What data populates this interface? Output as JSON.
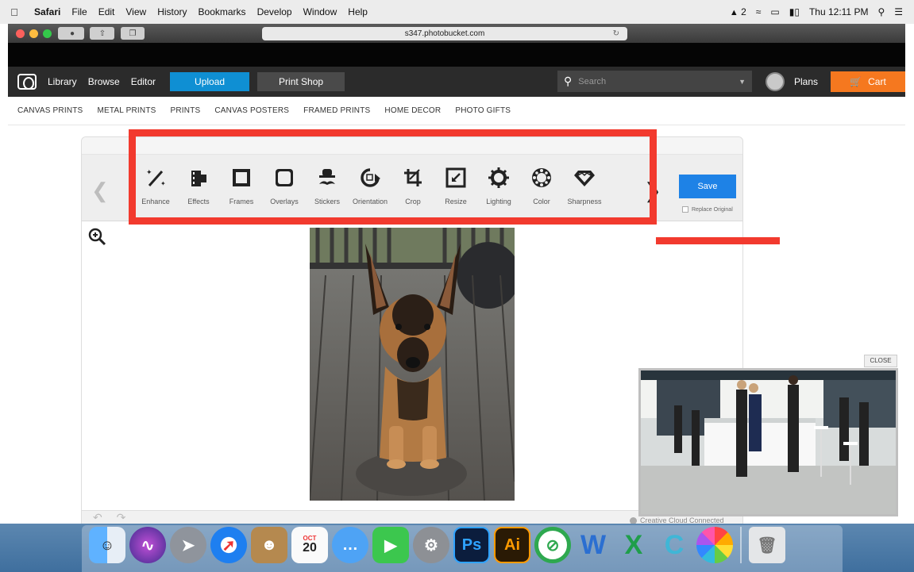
{
  "menubar": {
    "app": "Safari",
    "items": [
      "File",
      "Edit",
      "View",
      "History",
      "Bookmarks",
      "Develop",
      "Window",
      "Help"
    ],
    "status_badge": "2",
    "clock": "Thu 12:11 PM"
  },
  "safari": {
    "url": "s347.photobucket.com"
  },
  "nav": {
    "links": [
      "Library",
      "Browse",
      "Editor"
    ],
    "upload": "Upload",
    "print_shop": "Print Shop",
    "search_placeholder": "Search",
    "plans": "Plans",
    "cart": "Cart"
  },
  "categories": [
    "CANVAS PRINTS",
    "METAL PRINTS",
    "PRINTS",
    "CANVAS POSTERS",
    "FRAMED PRINTS",
    "HOME DECOR",
    "PHOTO GIFTS"
  ],
  "editor": {
    "tools": [
      {
        "label": "Enhance",
        "icon": "magic-wand-icon"
      },
      {
        "label": "Effects",
        "icon": "film-icon"
      },
      {
        "label": "Frames",
        "icon": "frame-icon"
      },
      {
        "label": "Overlays",
        "icon": "overlay-icon"
      },
      {
        "label": "Stickers",
        "icon": "hat-mustache-icon"
      },
      {
        "label": "Orientation",
        "icon": "rotate-icon"
      },
      {
        "label": "Crop",
        "icon": "crop-icon"
      },
      {
        "label": "Resize",
        "icon": "resize-icon"
      },
      {
        "label": "Lighting",
        "icon": "sun-icon"
      },
      {
        "label": "Color",
        "icon": "color-wheel-icon"
      },
      {
        "label": "Sharpness",
        "icon": "diamond-icon"
      }
    ],
    "save": "Save",
    "replace_original": "Replace Original"
  },
  "video": {
    "close": "CLOSE",
    "status": "Creative Cloud Connected"
  },
  "dock": {
    "calendar_month": "OCT",
    "calendar_day": "20",
    "apps": [
      "finder-icon",
      "siri-icon",
      "launchpad-icon",
      "safari-icon",
      "contacts-icon",
      "calendar-icon",
      "messages-icon",
      "facetime-icon",
      "system-preferences-icon",
      "photoshop-icon",
      "illustrator-icon",
      "no-sign-app-icon",
      "word-icon",
      "excel-icon",
      "c-app-icon",
      "photos-icon",
      "trash-icon"
    ],
    "ps_label": "Ps",
    "ai_label": "Ai",
    "w_label": "W",
    "x_label": "X",
    "c_label": "C"
  },
  "colors": {
    "highlight": "#f23a2e",
    "upload": "#0f8fd3",
    "cart": "#f5781f",
    "save": "#1e82e6"
  }
}
